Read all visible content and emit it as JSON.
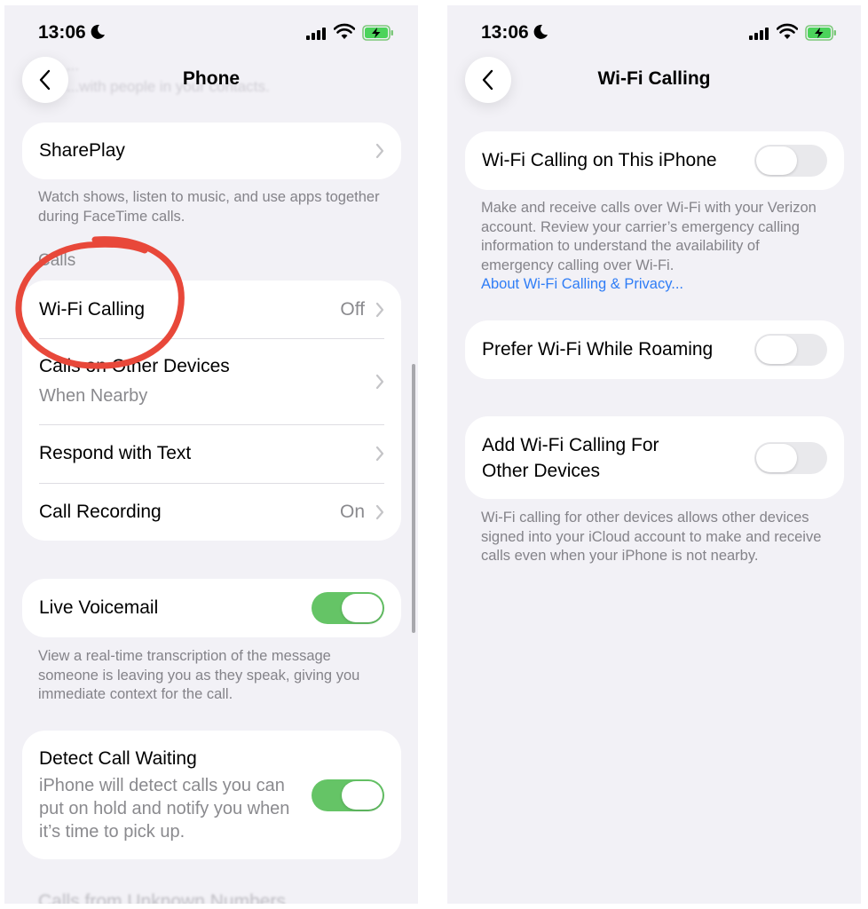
{
  "left": {
    "status": {
      "time": "13:06"
    },
    "nav": {
      "title": "Phone"
    },
    "ghost_text": [
      "...",
      "...with people in your contacts."
    ],
    "shareplay": {
      "label": "SharePlay",
      "footer": "Watch shows, listen to music, and use apps together during FaceTime calls."
    },
    "calls_header": "Calls",
    "calls_rows": [
      {
        "label": "Wi-Fi Calling",
        "value": "Off"
      },
      {
        "label": "Calls on Other Devices",
        "sub": "When Nearby"
      },
      {
        "label": "Respond with Text"
      },
      {
        "label": "Call Recording",
        "value": "On"
      }
    ],
    "live_voicemail": {
      "label": "Live Voicemail",
      "on": true,
      "footer": "View a real-time transcription of the message someone is leaving you as they speak, giving you immediate context for the call."
    },
    "detect_call_waiting": {
      "label": "Detect Call Waiting",
      "on": true,
      "description": "iPhone will detect calls you can put on hold and notify you when it’s time to pick up."
    },
    "bottom_ghost": "Calls from Unknown Numbers"
  },
  "right": {
    "status": {
      "time": "13:06"
    },
    "nav": {
      "title": "Wi-Fi Calling"
    },
    "wifi_calling_iphone": {
      "label": "Wi-Fi Calling on This iPhone",
      "on": false,
      "footer": "Make and receive calls over Wi-Fi with your Verizon account. Review your carrier’s emergency calling information to understand the availability of emergency calling over Wi-Fi.",
      "link": "About Wi-Fi Calling & Privacy..."
    },
    "prefer_roaming": {
      "label": "Prefer Wi-Fi While Roaming",
      "on": false
    },
    "other_devices": {
      "label": "Add Wi-Fi Calling For Other Devices",
      "on": false,
      "footer": "Wi-Fi calling for other devices allows other devices signed into your iCloud account to make and receive calls even when your iPhone is not nearby."
    }
  },
  "colors": {
    "background": "#f2f1f6",
    "toggle_on": "#65c466",
    "link": "#2f7df6",
    "annotation": "#e8483a"
  },
  "icons": [
    "moon-icon",
    "signal-icon",
    "wifi-icon",
    "battery-charging-icon",
    "chevron-left-icon",
    "chevron-right-icon"
  ]
}
